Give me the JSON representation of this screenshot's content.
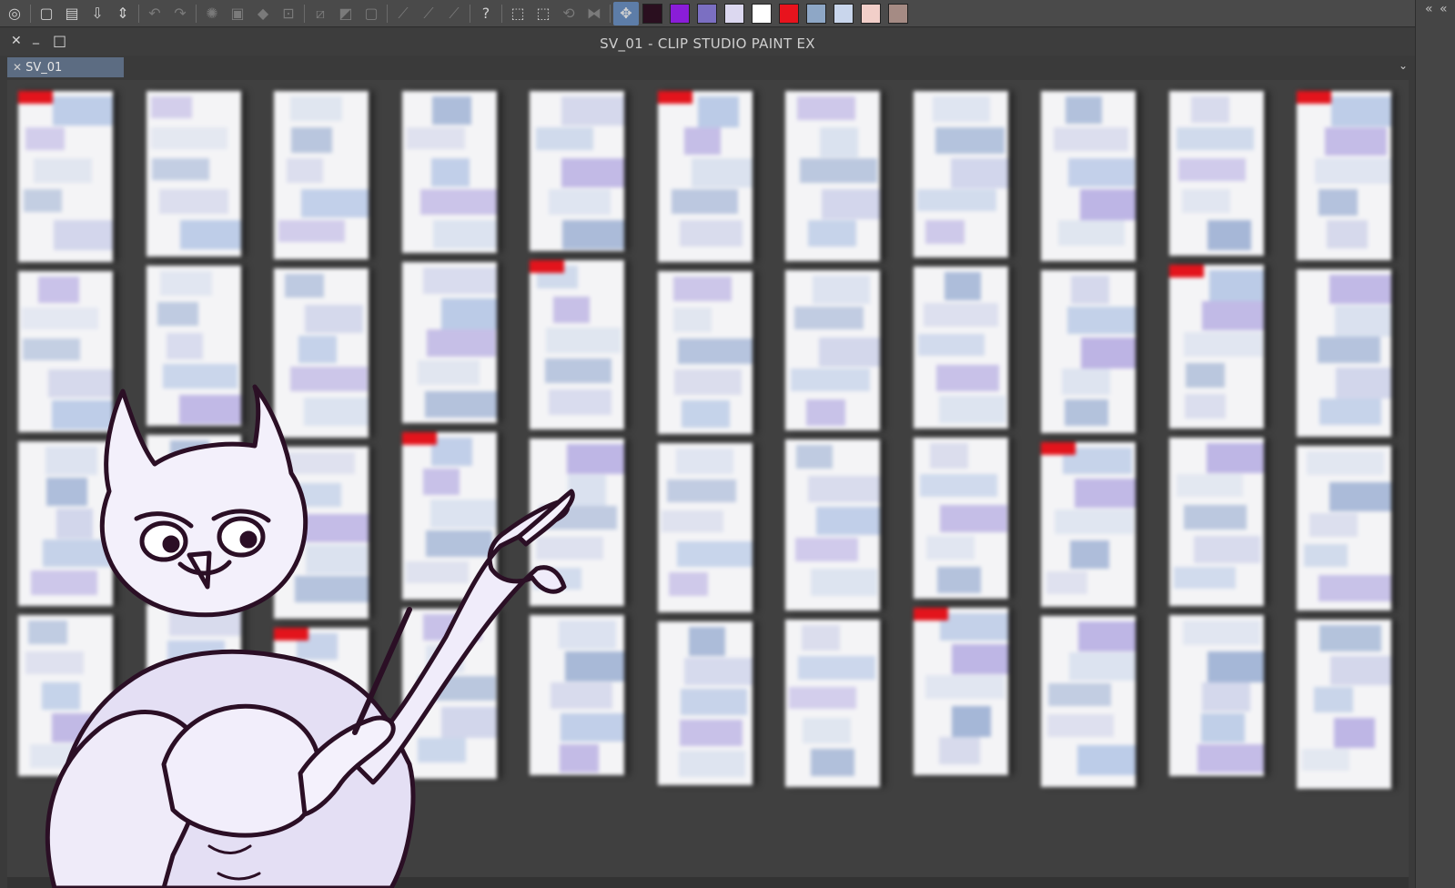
{
  "window": {
    "title": "SV_01 - CLIP STUDIO PAINT EX",
    "close_glyph": "✕",
    "minimize_glyph": "_",
    "maximize_glyph": "□"
  },
  "tab": {
    "label": "SV_01",
    "close_glyph": "✕",
    "menu_glyph": "⌄"
  },
  "right_panel": {
    "collapse_glyph": "«"
  },
  "toolbar": {
    "icons": [
      "app-menu-icon",
      "new-file-icon",
      "open-file-icon",
      "save-file-icon",
      "save-dropdown-icon",
      "undo-icon",
      "redo-icon",
      "erase-selection-icon",
      "clear-outside-icon",
      "fill-icon",
      "scale-icon",
      "deselect-icon",
      "invert-selection-icon",
      "border-icon",
      "snap-ruler-icon",
      "snap-special-icon",
      "snap-grid-icon",
      "help-icon",
      "select-layer-icon",
      "select-all-icon",
      "transform-icon",
      "flip-icon",
      "move-icon"
    ],
    "swatches": [
      "#2a0f1f",
      "#8a1dd8",
      "#7b6fc2",
      "#dcd8f0",
      "#ffffff",
      "#e8131d",
      "#8ea7c6",
      "#c9d6ec",
      "#f2cfc9",
      "#a58b84"
    ]
  },
  "page_columns": [
    {
      "pages": 4
    },
    {
      "pages": 4
    },
    {
      "pages": 4
    },
    {
      "pages": 4
    },
    {
      "pages": 4
    },
    {
      "pages": 4
    },
    {
      "pages": 4
    },
    {
      "pages": 4
    },
    {
      "pages": 4
    },
    {
      "pages": 4
    },
    {
      "pages": 4
    }
  ],
  "accent_colors": {
    "page_tint": "#b7c8e6",
    "purple_tint": "#b9b0e3",
    "red_mark": "#e3141c"
  }
}
